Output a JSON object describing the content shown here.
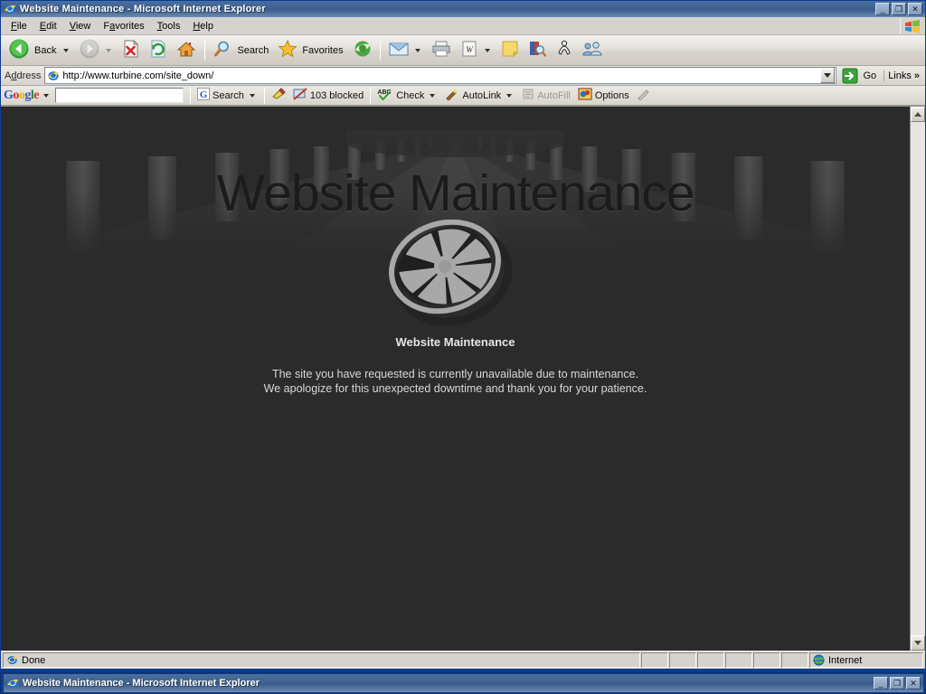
{
  "window": {
    "title": "Website Maintenance - Microsoft Internet Explorer",
    "icon": "ie-icon",
    "controls": {
      "minimize": "_",
      "restore": "❐",
      "close": "✕"
    }
  },
  "menu": {
    "items": [
      {
        "label": "File",
        "accel": "F"
      },
      {
        "label": "Edit",
        "accel": "E"
      },
      {
        "label": "View",
        "accel": "V"
      },
      {
        "label": "Favorites",
        "accel": "a"
      },
      {
        "label": "Tools",
        "accel": "T"
      },
      {
        "label": "Help",
        "accel": "H"
      }
    ],
    "branding_icon": "windows-flag-icon"
  },
  "toolbar": {
    "back_label": "Back",
    "back_icon": "back-arrow-icon",
    "forward_icon": "forward-arrow-icon",
    "stop_icon": "stop-icon",
    "refresh_icon": "refresh-icon",
    "home_icon": "home-icon",
    "search_label": "Search",
    "search_icon": "magnifier-icon",
    "favorites_label": "Favorites",
    "favorites_icon": "star-icon",
    "media_icon": "media-icon",
    "mail_icon": "mail-icon",
    "print_icon": "printer-icon",
    "edit_icon": "word-edit-icon",
    "notes_icon": "note-icon",
    "research_icon": "research-icon",
    "messenger_icon": "messenger-icon",
    "people_icon": "people-icon"
  },
  "address": {
    "label": "Address",
    "favicon": "ie-page-icon",
    "url": "http://www.turbine.com/site_down/",
    "dropdown_icon": "chevron-down-icon",
    "go_label": "Go",
    "go_icon": "go-arrow-icon",
    "links_label": "Links",
    "links_chevron": "»"
  },
  "google_toolbar": {
    "logo": {
      "g1": "G",
      "o1": "o",
      "o2": "o",
      "g2": "g",
      "l": "l",
      "e": "e"
    },
    "logo_caret_icon": "chevron-down-icon",
    "search_value": "",
    "search_placeholder": "",
    "search_label": "Search",
    "search_icon": "google-g-icon",
    "highlight_icon": "highlight-icon",
    "blocked_label": "103 blocked",
    "blocked_icon": "popup-blocker-icon",
    "check_label": "Check",
    "check_icon": "spellcheck-abc-icon",
    "autolink_label": "AutoLink",
    "autolink_icon": "wand-icon",
    "autofill_label": "AutoFill",
    "autofill_icon": "autofill-icon",
    "options_label": "Options",
    "options_icon": "options-icon",
    "pen_icon": "pencil-icon"
  },
  "page": {
    "background_color": "#2b2b2b",
    "hero_title": "Website Maintenance",
    "logo_icon": "turbine-wheel-logo",
    "sub_title": "Website Maintenance",
    "body_line1": "The site you have requested is currently unavailable due to maintenance.",
    "body_line2": "We apologize for this unexpected downtime and thank you for your patience."
  },
  "scrollbar": {
    "up_icon": "scroll-up-arrow-icon",
    "down_icon": "scroll-down-arrow-icon"
  },
  "statusbar": {
    "status_text": "Done",
    "status_icon": "ie-icon",
    "zone_label": "Internet",
    "zone_icon": "globe-icon"
  },
  "background_window": {
    "title": "Website Maintenance - Microsoft Internet Explorer",
    "icon": "ie-icon",
    "controls": {
      "minimize": "_",
      "restore": "❐",
      "close": "✕"
    }
  }
}
